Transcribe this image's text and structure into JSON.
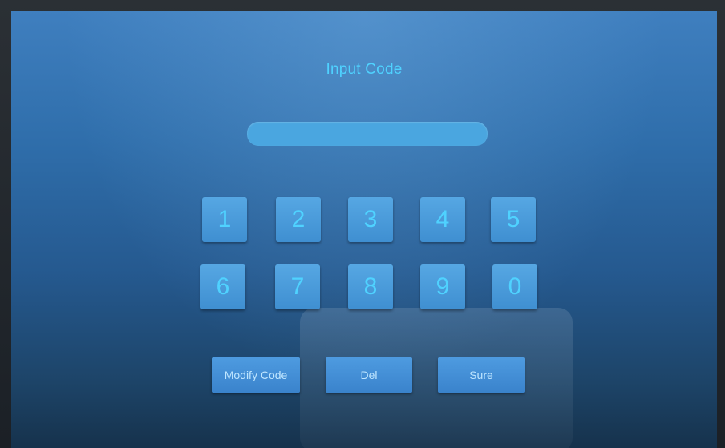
{
  "title": "Input Code",
  "input": {
    "value": "",
    "placeholder": ""
  },
  "keypad": {
    "row1": [
      "1",
      "2",
      "3",
      "4",
      "5"
    ],
    "row2": [
      "6",
      "7",
      "8",
      "9",
      "0"
    ]
  },
  "actions": {
    "modify": "Modify Code",
    "del": "Del",
    "sure": "Sure"
  },
  "colors": {
    "accent_text": "#4fd2ff",
    "key_bg": "#4a9ad8",
    "screen_bg": "#2f6eab"
  }
}
